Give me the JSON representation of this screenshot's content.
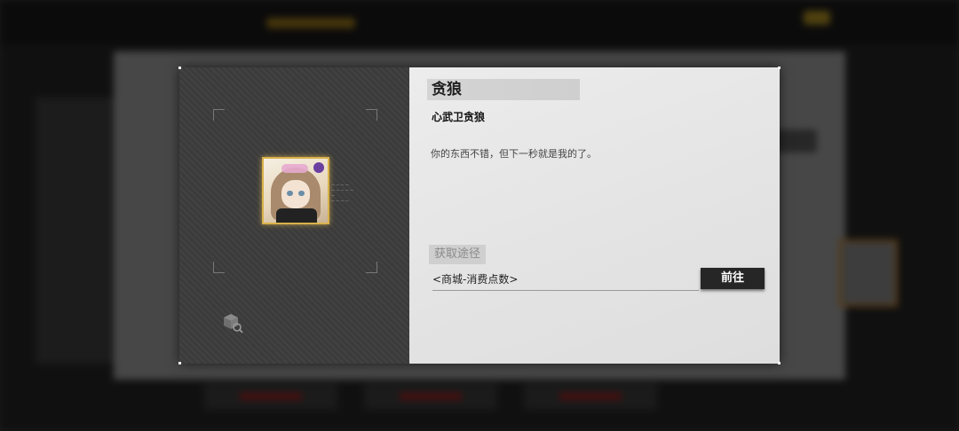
{
  "item": {
    "name": "贪狼",
    "full_name": "心武卫贪狼",
    "description": "你的东西不错，但下一秒就是我的了。",
    "tiny_info": [
      "— — — —",
      "— — — — — —",
      "— — — —"
    ]
  },
  "source": {
    "label": "获取途径",
    "entries": [
      {
        "text": "<商城-消费点数>",
        "button_label": "前往"
      }
    ]
  },
  "icons": {
    "portrait": "character-portrait",
    "lookup": "cube-search-icon"
  },
  "colors": {
    "portrait_border": "#d9b24a",
    "button_bg": "#262626",
    "left_panel": "#3b3b3b",
    "right_panel": "#e6e6e6"
  }
}
